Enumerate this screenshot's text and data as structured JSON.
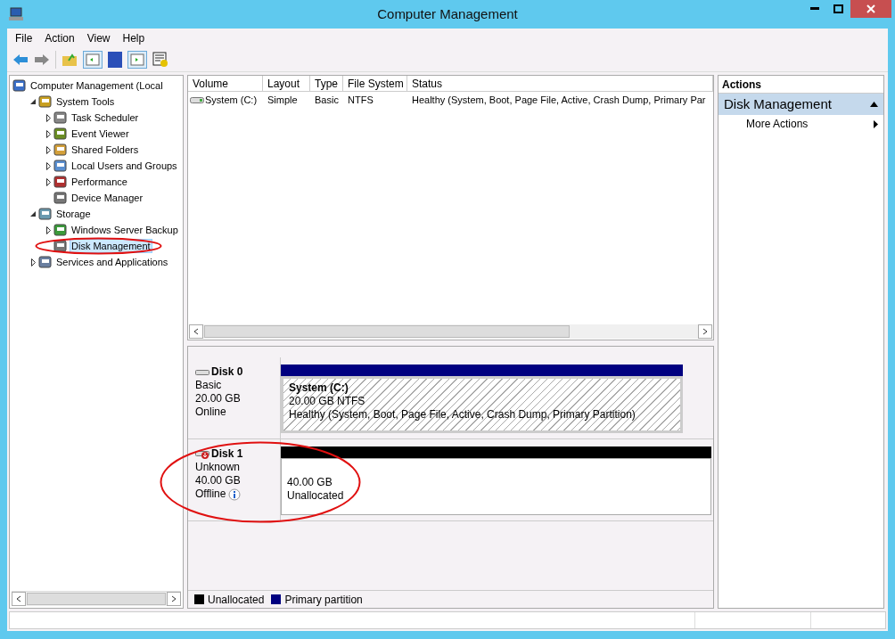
{
  "window": {
    "title": "Computer Management"
  },
  "menu": [
    "File",
    "Action",
    "View",
    "Help"
  ],
  "tree": [
    {
      "label": "Computer Management (Local",
      "kind": "root",
      "selected": false,
      "children": [
        {
          "label": "System Tools",
          "kind": "expanded",
          "selected": false,
          "children": [
            {
              "label": "Task Scheduler",
              "kind": "collapsed",
              "selected": false
            },
            {
              "label": "Event Viewer",
              "kind": "collapsed",
              "selected": false
            },
            {
              "label": "Shared Folders",
              "kind": "collapsed",
              "selected": false
            },
            {
              "label": "Local Users and Groups",
              "kind": "collapsed",
              "selected": false
            },
            {
              "label": "Performance",
              "kind": "collapsed",
              "selected": false
            },
            {
              "label": "Device Manager",
              "kind": "leaf",
              "selected": false
            }
          ]
        },
        {
          "label": "Storage",
          "kind": "expanded",
          "selected": false,
          "children": [
            {
              "label": "Windows Server Backup",
              "kind": "collapsed",
              "selected": false
            },
            {
              "label": "Disk Management",
              "kind": "leaf",
              "selected": true
            }
          ]
        },
        {
          "label": "Services and Applications",
          "kind": "collapsed",
          "selected": false
        }
      ]
    }
  ],
  "table": {
    "columns": [
      "Volume",
      "Layout",
      "Type",
      "File System",
      "Status"
    ],
    "rows": [
      [
        "System (C:)",
        "Simple",
        "Basic",
        "NTFS",
        "Healthy (System, Boot, Page File, Active, Crash Dump, Primary Par"
      ]
    ]
  },
  "disks": [
    {
      "name": "Disk 0",
      "type": "Basic",
      "size": "20.00 GB",
      "status": "Online",
      "info": false,
      "color": "#000080",
      "partition": {
        "title": "System  (C:)",
        "lines": [
          "20.00 GB NTFS",
          "Healthy (System, Boot, Page File, Active, Crash Dump, Primary Partition)"
        ],
        "hatched": true
      }
    },
    {
      "name": "Disk 1",
      "type": "Unknown",
      "size": "40.00 GB",
      "status": "Offline",
      "info": true,
      "color": "#000000",
      "partition": {
        "lines": [
          "40.00 GB",
          "Unallocated"
        ],
        "hatched": false
      }
    }
  ],
  "legend": [
    {
      "label": "Unallocated",
      "color": "#000000"
    },
    {
      "label": "Primary partition",
      "color": "#000080"
    }
  ],
  "actions": {
    "title": "Actions",
    "section": "Disk Management",
    "items": [
      "More Actions"
    ]
  }
}
